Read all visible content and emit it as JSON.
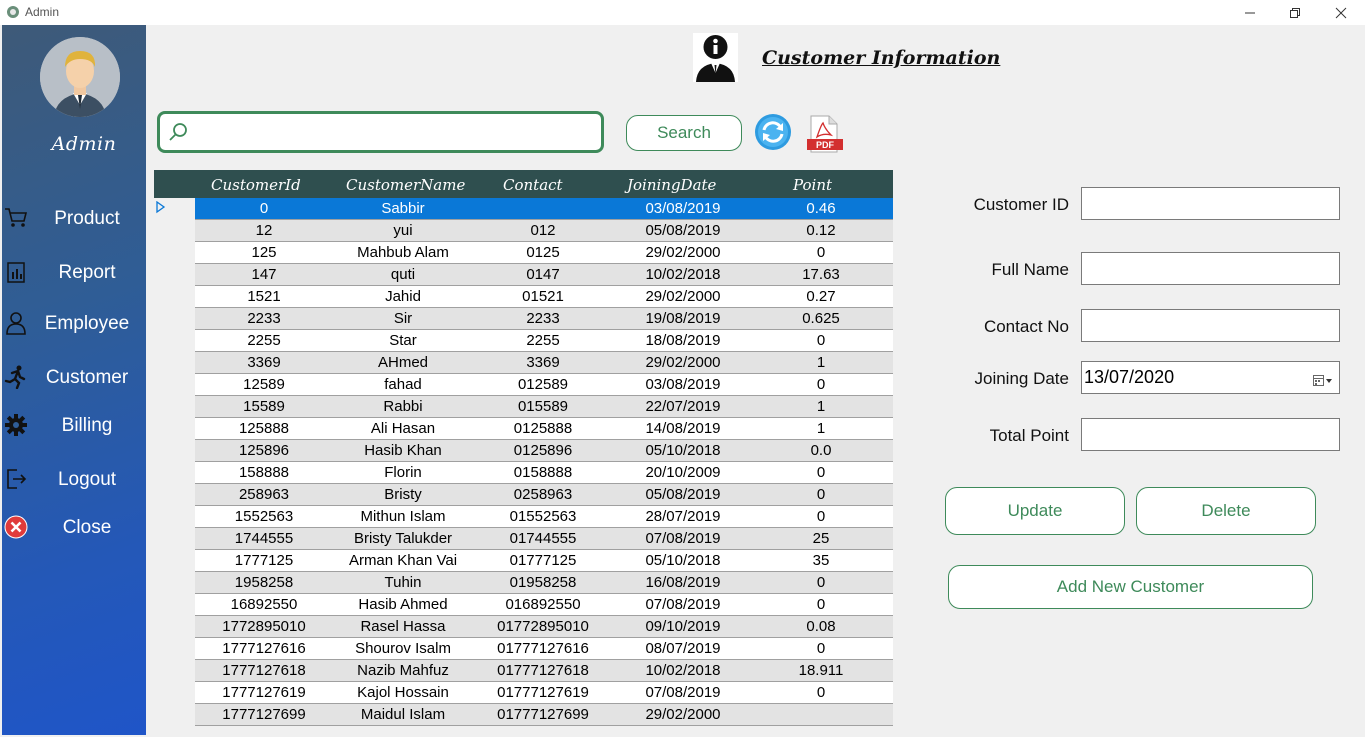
{
  "window": {
    "title": "Admin"
  },
  "sidebar": {
    "user": "Admin",
    "items": [
      {
        "label": "Product",
        "icon": "cart-icon"
      },
      {
        "label": "Report",
        "icon": "report-icon"
      },
      {
        "label": "Employee",
        "icon": "employee-icon"
      },
      {
        "label": "Customer",
        "icon": "runner-icon"
      },
      {
        "label": "Billing",
        "icon": "gear-icon"
      },
      {
        "label": "Logout",
        "icon": "logout-icon"
      },
      {
        "label": "Close",
        "icon": "close-icon"
      }
    ]
  },
  "header": {
    "title": "Customer Information"
  },
  "search": {
    "value": "",
    "placeholder": "",
    "button": "Search"
  },
  "table": {
    "columns": [
      "CustomerId",
      "CustomerName",
      "Contact",
      "JoiningDate",
      "Point"
    ],
    "rows": [
      [
        "0",
        "Sabbir",
        "",
        "03/08/2019",
        "0.46"
      ],
      [
        "12",
        "yui",
        "012",
        "05/08/2019",
        "0.12"
      ],
      [
        "125",
        "Mahbub Alam",
        "0125",
        "29/02/2000",
        "0"
      ],
      [
        "147",
        "quti",
        "0147",
        "10/02/2018",
        "17.63"
      ],
      [
        "1521",
        "Jahid",
        "01521",
        "29/02/2000",
        "0.27"
      ],
      [
        "2233",
        "Sir",
        "2233",
        "19/08/2019",
        "0.625"
      ],
      [
        "2255",
        "Star",
        "2255",
        "18/08/2019",
        "0"
      ],
      [
        "3369",
        "AHmed",
        "3369",
        "29/02/2000",
        "1"
      ],
      [
        "12589",
        "fahad",
        "012589",
        "03/08/2019",
        "0"
      ],
      [
        "15589",
        "Rabbi",
        "015589",
        "22/07/2019",
        "1"
      ],
      [
        "125888",
        "Ali Hasan",
        "0125888",
        "14/08/2019",
        "1"
      ],
      [
        "125896",
        "Hasib Khan",
        "0125896",
        "05/10/2018",
        "0.0"
      ],
      [
        "158888",
        "Florin",
        "0158888",
        "20/10/2009",
        "0"
      ],
      [
        "258963",
        "Bristy",
        "0258963",
        "05/08/2019",
        "0"
      ],
      [
        "1552563",
        "Mithun Islam",
        "01552563",
        "28/07/2019",
        "0"
      ],
      [
        "1744555",
        "Bristy Talukder",
        "01744555",
        "07/08/2019",
        "25"
      ],
      [
        "1777125",
        "Arman Khan Vai",
        "01777125",
        "05/10/2018",
        "35"
      ],
      [
        "1958258",
        "Tuhin",
        "01958258",
        "16/08/2019",
        "0"
      ],
      [
        "16892550",
        "Hasib Ahmed",
        "016892550",
        "07/08/2019",
        "0"
      ],
      [
        "1772895010",
        "Rasel Hassa",
        "01772895010",
        "09/10/2019",
        "0.08"
      ],
      [
        "1777127616",
        "Shourov Isalm",
        "01777127616",
        "08/07/2019",
        "0"
      ],
      [
        "1777127618",
        "Nazib Mahfuz",
        "01777127618",
        "10/02/2018",
        "18.911"
      ],
      [
        "1777127619",
        "Kajol Hossain",
        "01777127619",
        "07/08/2019",
        "0"
      ],
      [
        "1777127699",
        "Maidul Islam",
        "01777127699",
        "29/02/2000",
        ""
      ]
    ],
    "selected_row": 0
  },
  "form": {
    "customer_id_label": "Customer ID",
    "customer_id_value": "",
    "full_name_label": "Full Name",
    "full_name_value": "",
    "contact_label": "Contact No",
    "contact_value": "",
    "joining_date_label": "Joining Date",
    "joining_date_value": "13/07/2020",
    "total_point_label": "Total Point",
    "total_point_value": "",
    "update_button": "Update",
    "delete_button": "Delete",
    "add_button": "Add New Customer"
  },
  "colors": {
    "accent_green": "#3e8a5a",
    "header_dark": "#2f4f4f",
    "selection_blue": "#0a78d7"
  }
}
